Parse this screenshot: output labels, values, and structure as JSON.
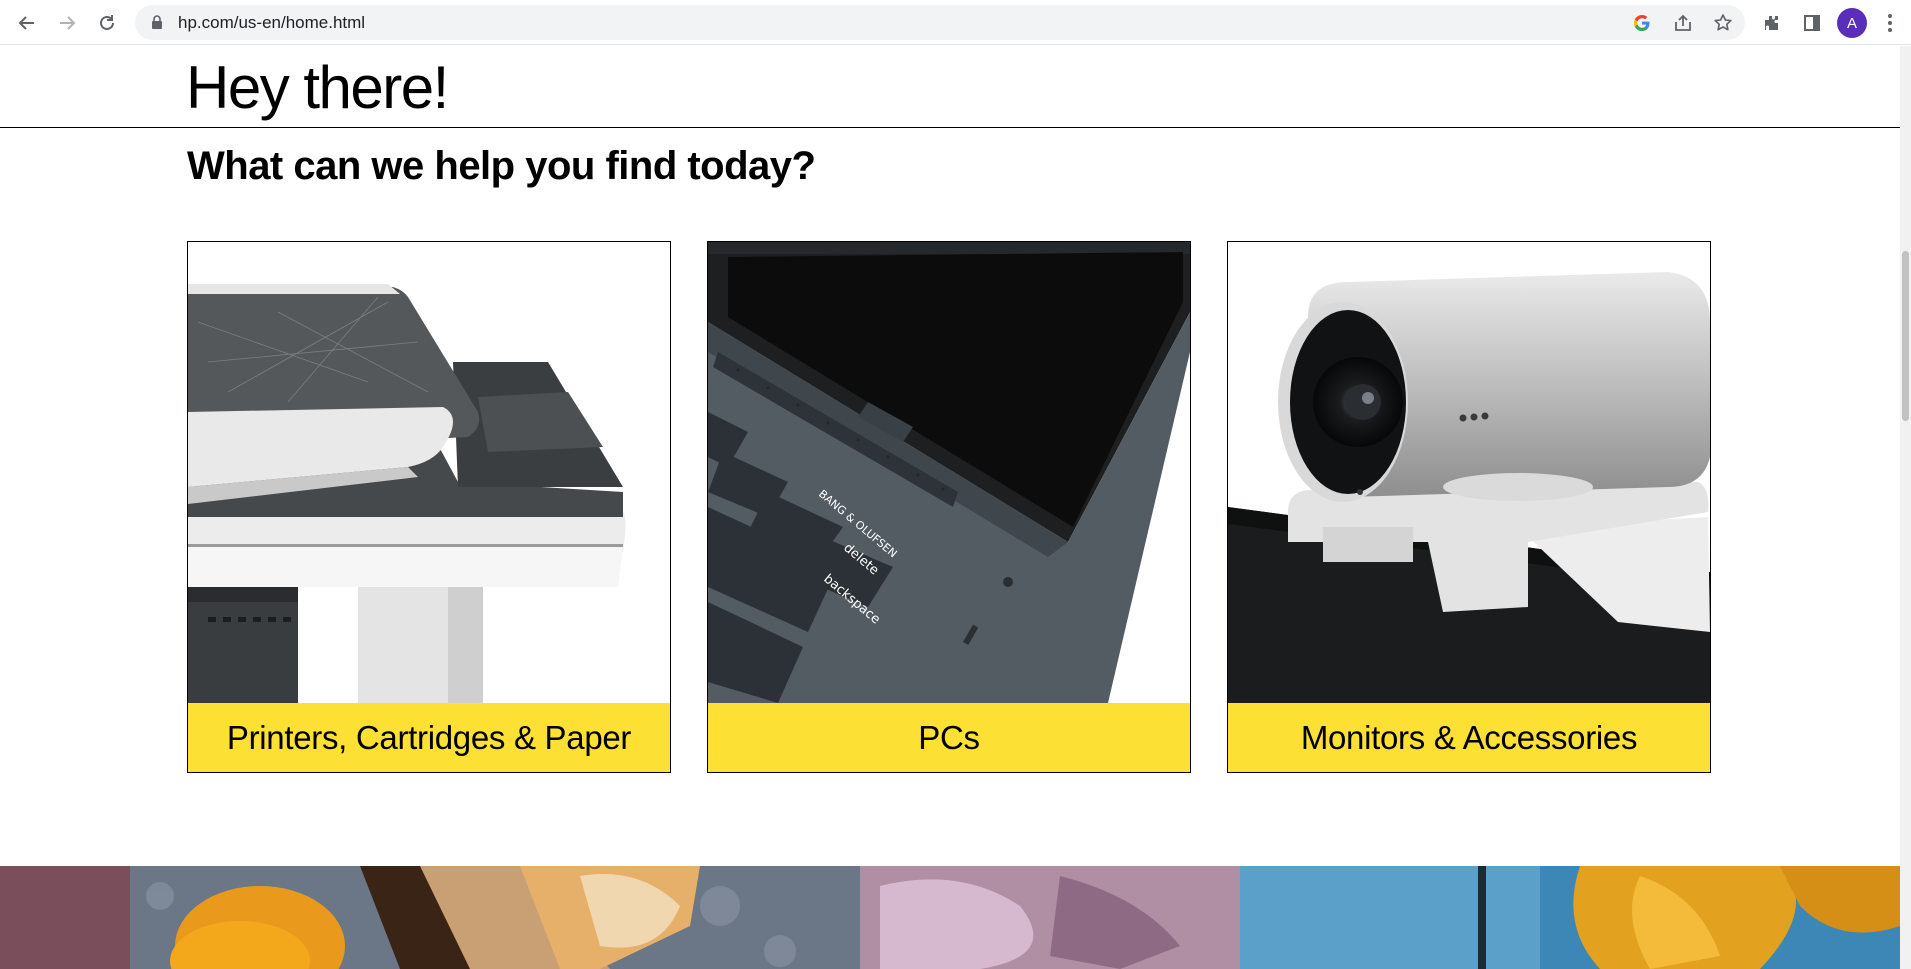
{
  "browser": {
    "url": "hp.com/us-en/home.html",
    "avatar_initial": "A",
    "icons": [
      "back-icon",
      "forward-icon",
      "reload-icon",
      "lock-icon",
      "google-icon",
      "share-icon",
      "bookmark-star-icon",
      "extensions-icon",
      "side-panel-icon",
      "more-menu-icon"
    ]
  },
  "page": {
    "greeting": "Hey there!",
    "subheading": "What can we help you find today?"
  },
  "categories": [
    {
      "label": "Printers, Cartridges & Paper",
      "image": "printer-closeup"
    },
    {
      "label": "PCs",
      "image": "laptop-keyboard-closeup",
      "keyboard": {
        "brand": "BANG & OLUFSEN",
        "key_delete": "delete",
        "key_backspace": "backspace"
      }
    },
    {
      "label": "Monitors & Accessories",
      "image": "webcam-on-monitor"
    }
  ],
  "colors": {
    "accent_yellow": "#fde034",
    "text": "#000000",
    "chrome_bg": "#f1f3f4",
    "avatar": "#5a2dbb"
  }
}
